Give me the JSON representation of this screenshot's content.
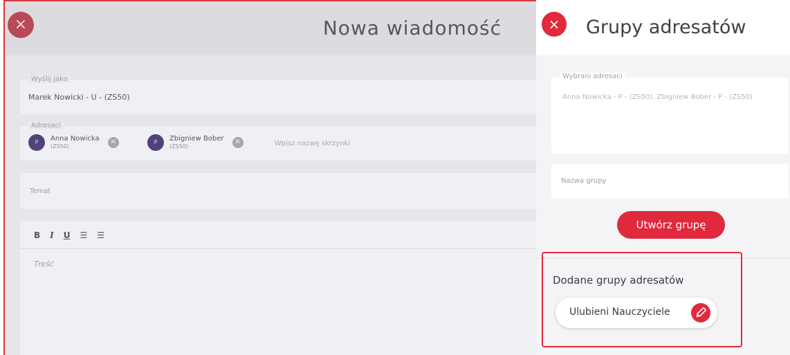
{
  "composer": {
    "title": "Nowa wiadomość",
    "close_glyph": "×",
    "sender": {
      "legend": "Wyślij jako",
      "value": "Marek Nowicki - U - (ZS50)"
    },
    "recipients": {
      "legend": "Adresaci",
      "chips": [
        {
          "initial": "P",
          "name": "Anna Nowicka",
          "sub": "(ZS50)"
        },
        {
          "initial": "P",
          "name": "Zbigniew Bober",
          "sub": "(ZS50)"
        }
      ],
      "input_placeholder": "Wpisz nazwę skrzynki"
    },
    "subject": {
      "placeholder": "Temat"
    },
    "editor": {
      "toolbar": {
        "bold": "B",
        "italic": "I",
        "underline": "U",
        "ordered": "☰",
        "unordered": "☰"
      },
      "placeholder": "Treść"
    }
  },
  "panel": {
    "title": "Grupy adresatów",
    "close_glyph": "×",
    "selected": {
      "legend": "Wybrani adresaci",
      "value": "Anna Nowicka - P - (ZS50), Zbigniew Bober - P - (ZS50)"
    },
    "group_name": {
      "placeholder": "Nazwa grupy"
    },
    "create_button": "Utwórz grupę",
    "added_groups": {
      "title": "Dodane grupy adresatów",
      "items": [
        {
          "label": "Ulubieni Nauczyciele"
        }
      ]
    }
  },
  "colors": {
    "accent": "#e0293c",
    "avatar": "#51437a"
  }
}
